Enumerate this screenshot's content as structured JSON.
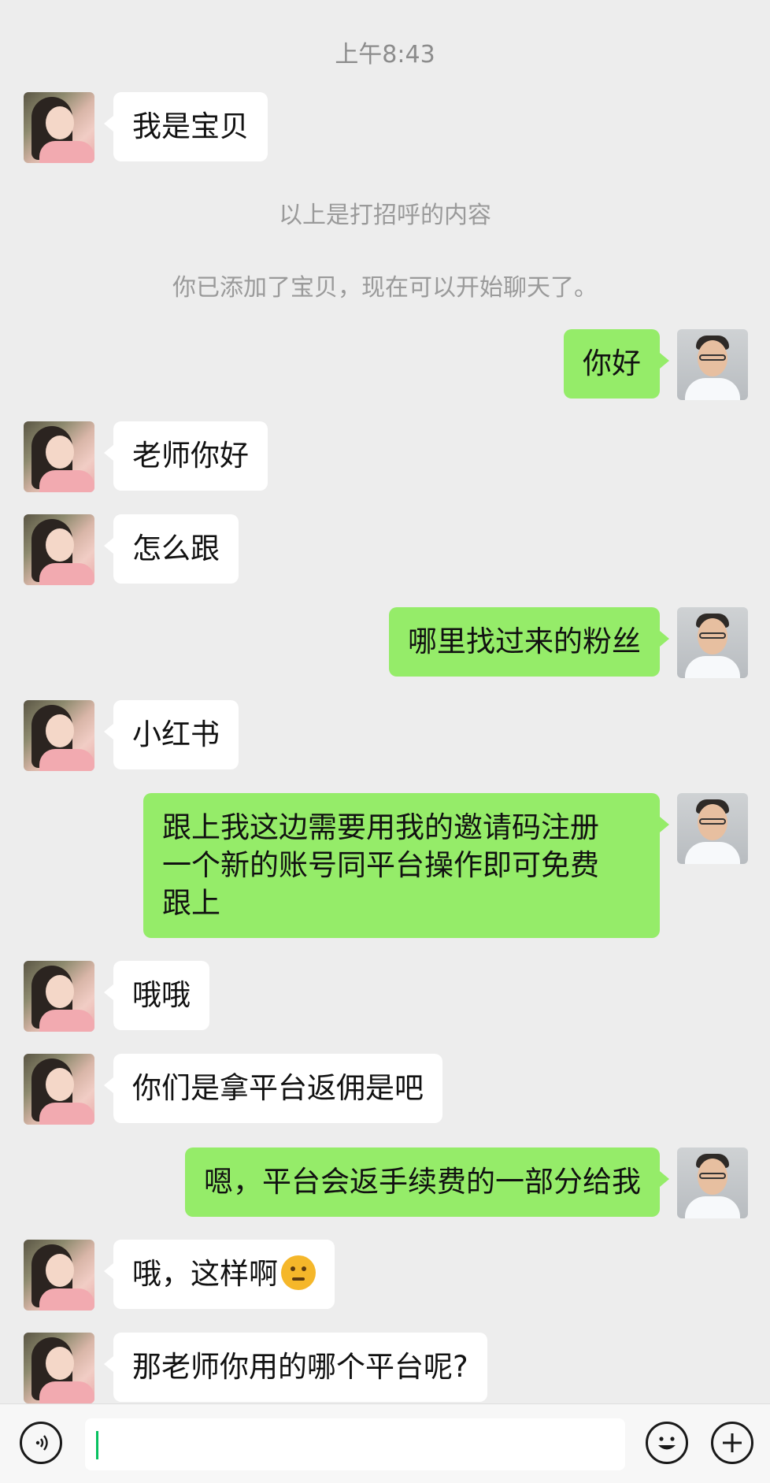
{
  "chat": {
    "timestamp": "上午8:43",
    "system_messages": [
      "以上是打招呼的内容",
      "你已添加了宝贝，现在可以开始聊天了。"
    ],
    "messages": [
      {
        "side": "in",
        "text": "我是宝贝"
      },
      {
        "side": "out",
        "text": "你好"
      },
      {
        "side": "in",
        "text": "老师你好"
      },
      {
        "side": "in",
        "text": "怎么跟"
      },
      {
        "side": "out",
        "text": "哪里找过来的粉丝"
      },
      {
        "side": "in",
        "text": "小红书"
      },
      {
        "side": "out",
        "lines": [
          "跟上我这边需要用我的邀请码注册",
          "一个新的账号同平台操作即可免费",
          "跟上"
        ]
      },
      {
        "side": "in",
        "text": "哦哦"
      },
      {
        "side": "in",
        "text": "你们是拿平台返佣是吧"
      },
      {
        "side": "out",
        "text": "嗯，平台会返手续费的一部分给我"
      },
      {
        "side": "in",
        "text": "哦，这样啊",
        "emoji": "thinking-face-emoji"
      },
      {
        "side": "in",
        "text": "那老师你用的哪个平台呢?"
      }
    ]
  },
  "input_bar": {
    "voice_icon": "voice-icon",
    "emoji_icon": "smile-icon",
    "plus_icon": "plus-icon",
    "text_value": ""
  },
  "colors": {
    "background": "#ededed",
    "incoming_bubble": "#ffffff",
    "outgoing_bubble": "#95ec69",
    "caret": "#07c160"
  }
}
